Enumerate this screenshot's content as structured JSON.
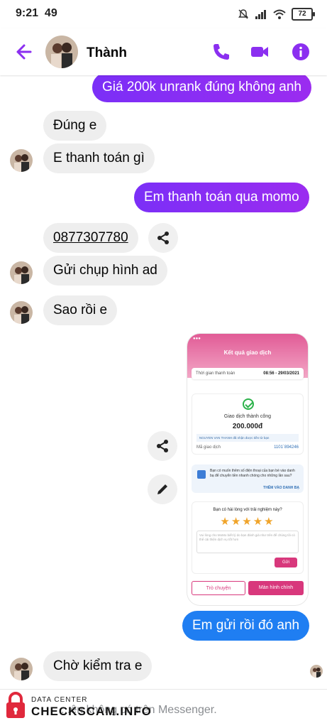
{
  "status": {
    "time": "9:21",
    "notification_count": "49",
    "battery": "72"
  },
  "header": {
    "contact_name": "Thành"
  },
  "messages": {
    "m1": "Giá 200k unrank đúng không anh",
    "m2": "Đúng e",
    "m3": "E thanh toán gì",
    "m4": "Em thanh toán qua momo",
    "m5": "0877307780",
    "m6": "Gửi chụp hình ad",
    "m7": "Sao rồi e",
    "m8": "Em gửi rồi đó anh",
    "m9": "Chờ kiểm tra e"
  },
  "receipt": {
    "title": "Kết quả giao dịch",
    "time_label": "Thời gian thanh toán",
    "time_value": "08:56 - 29/03/2021",
    "status": "Giao dịch thành công",
    "amount": "200.000đ",
    "receiver_note": "NGUYEN VAN THANH đã nhận được tiền từ bạn",
    "txn_label": "Mã giao dịch",
    "txn_value": "1101`894246",
    "save_prompt": "Bạn có muốn thêm số điện thoại của bạn bè vào danh bạ để chuyển tiền nhanh chóng cho những lần sau?",
    "save_link": "THÊM VÀO DANH BẠ",
    "rating_question": "Bạn có hài lòng với trải nghiệm này?",
    "stars": "★★★★★",
    "feedback_placeholder": "Vui lòng cho MoMo biết lý do bạn đánh giá như trên để chúng tôi có thể cải thiện dịch vụ tốt hơn",
    "send_label": "Gửi",
    "chat_btn": "Trò chuyện",
    "home_btn": "Màn hình chính"
  },
  "footer": {
    "note": "...ên không có trên Messenger."
  },
  "watermark": {
    "line1": "DATA CENTER",
    "line2": "CHECKSCAM.INFO"
  },
  "colors": {
    "accent": "#8b2ff0",
    "blue": "#1f7ef2",
    "momo": "#d8387c"
  }
}
